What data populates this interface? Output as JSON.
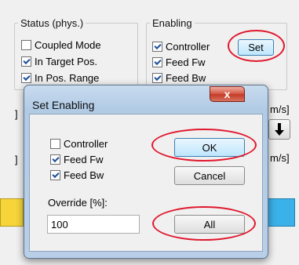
{
  "main": {
    "status_group": {
      "title": "Status (phys.)",
      "items": [
        {
          "label": "Coupled Mode",
          "checked": false
        },
        {
          "label": "In Target Pos.",
          "checked": true
        },
        {
          "label": "In Pos. Range",
          "checked": true
        }
      ]
    },
    "enabling_group": {
      "title": "Enabling",
      "items": [
        {
          "label": "Controller",
          "checked": true
        },
        {
          "label": "Feed Fw",
          "checked": true
        },
        {
          "label": "Feed Bw",
          "checked": true
        }
      ],
      "set_label": "Set"
    },
    "side_labels": {
      "right_unit_1": "m/s]",
      "right_unit_2": "m/s]",
      "left_bracket_1": "]",
      "left_bracket_2": "]"
    }
  },
  "dialog": {
    "title": "Set Enabling",
    "close_glyph": "x",
    "checkboxes": [
      {
        "label": "Controller",
        "checked": false
      },
      {
        "label": "Feed Fw",
        "checked": true
      },
      {
        "label": "Feed Bw",
        "checked": true
      }
    ],
    "ok_label": "OK",
    "cancel_label": "Cancel",
    "override_label": "Override [%]:",
    "override_value": "100",
    "all_label": "All"
  },
  "colors": {
    "annotation_ring": "#e0182d",
    "dialog_frame": "#b9cfe7",
    "checkmark": "#1c4f9c"
  }
}
